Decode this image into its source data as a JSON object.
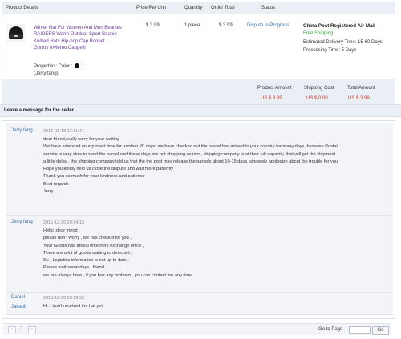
{
  "table": {
    "headers": {
      "details": "Product Details",
      "price": "Price Per Unit",
      "quantity": "Quantity",
      "order_total": "Order Total",
      "status": "Status"
    }
  },
  "product": {
    "title_lines": [
      "Winter Hat For Women And Men Beanies",
      "RAIDERS Warm Outdoor Sport Beanie",
      "Knitted Hats Hip-hop Cap Bonnet",
      "Gorros Invierno Cappelli"
    ],
    "properties_label": "Properties: Color :",
    "color_value": "1",
    "buyer": "(Jerry fang)",
    "price": "$ 3.99",
    "quantity": "1 piece",
    "order_total": "$ 3.99",
    "status": "Dispute in Progress",
    "shipping_method": "China Post Registered Air Mail",
    "free_shipping": "Free Shipping",
    "delivery_time": "Estimated Delivery Time:  15-60 Days",
    "processing_time": "Processing Time:  5 Days"
  },
  "totals": {
    "product_amount_label": "Product Amount",
    "shipping_cost_label": "Shipping Cost",
    "total_amount_label": "Total Amount",
    "product_amount": "US $ 3.99",
    "shipping_cost": "US $ 0.00",
    "total_amount": "US $ 3.99"
  },
  "messages": {
    "title": "Leave a message for the seller",
    "items": [
      {
        "sender": "Jerry fang",
        "time": "2016-01-18 17:11:47",
        "lines": [
          "dear friend,really sorry for your waiting",
          "We have extended your protect time for another 20 days, we have checked out the parcel has arrived in your country for many days, because Postal",
          "service is very slow to send the parcel and these days are hot shopping season, shipping company is at their full capacity, that will get the shipment",
          "a little delay , the shipping company told us that the the post may release the parcels about 10-15 days. sincerely apologize about the trouble for you.",
          "Hope you kindly help us close the dispute and wait more patiently",
          "Thank you so much for your kindness and patience",
          "Best regards",
          "Jerry"
        ]
      },
      {
        "sender": "Jerry fang",
        "time": "2015-12-30 20:14:13",
        "lines": [
          "Hello ,dear friend ,",
          "please don't worry , we has check it for you ,",
          "Your Goods has arrival importers exchange office ,",
          "There are a lot of goods waiting to detected ,",
          "So , Logistics information is not up to date .",
          "Please wait some days , friend .",
          "we are always  here , if you has any problem , you can contact me any time"
        ]
      },
      {
        "sender": "Daniel",
        "time": "2015-12-30 03:19:32",
        "lines": []
      },
      {
        "sender": "Jakabll",
        "time": "",
        "lines": [
          "Hi. I don't received the hat yet."
        ]
      }
    ]
  },
  "pagination": {
    "prev": "‹",
    "current_page": "1",
    "next": "›",
    "goto_label": "Go to Page",
    "go_button": "Go"
  },
  "colors": {
    "header_bg": "#eaeef5",
    "link": "#3a6ea5",
    "price_red": "#d9322e",
    "free_green": "#39a33d",
    "title_purple": "#6a3a9a"
  }
}
